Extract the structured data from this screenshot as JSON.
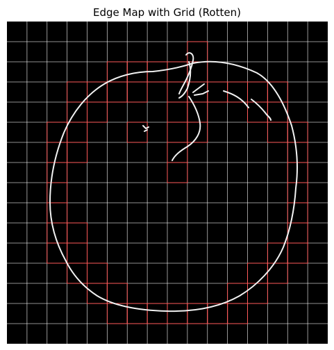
{
  "figure": {
    "title": "Edge Map with Grid (Rotten)"
  },
  "image": {
    "description_colors": {
      "background": "#000000",
      "edges": "#ffffff",
      "grid_lines": "#ffffff",
      "highlight_cells": "#ff5a5a"
    },
    "grid": {
      "columns": 16,
      "rows": 16,
      "highlighted_cells": [
        [
          1,
          9
        ],
        [
          2,
          5
        ],
        [
          2,
          6
        ],
        [
          2,
          7
        ],
        [
          2,
          8
        ],
        [
          2,
          9
        ],
        [
          3,
          3
        ],
        [
          3,
          4
        ],
        [
          3,
          5
        ],
        [
          3,
          6
        ],
        [
          3,
          8
        ],
        [
          3,
          9
        ],
        [
          3,
          10
        ],
        [
          3,
          11
        ],
        [
          3,
          12
        ],
        [
          3,
          13
        ],
        [
          4,
          3
        ],
        [
          4,
          4
        ],
        [
          4,
          8
        ],
        [
          4,
          9
        ],
        [
          4,
          12
        ],
        [
          4,
          13
        ],
        [
          5,
          2
        ],
        [
          5,
          3
        ],
        [
          5,
          6
        ],
        [
          5,
          8
        ],
        [
          5,
          9
        ],
        [
          5,
          13
        ],
        [
          5,
          14
        ],
        [
          6,
          2
        ],
        [
          6,
          3
        ],
        [
          6,
          8
        ],
        [
          6,
          14
        ],
        [
          7,
          2
        ],
        [
          7,
          8
        ],
        [
          7,
          14
        ],
        [
          8,
          2
        ],
        [
          8,
          14
        ],
        [
          9,
          2
        ],
        [
          9,
          14
        ],
        [
          10,
          2
        ],
        [
          10,
          3
        ],
        [
          10,
          14
        ],
        [
          11,
          2
        ],
        [
          11,
          3
        ],
        [
          11,
          13
        ],
        [
          11,
          14
        ],
        [
          12,
          3
        ],
        [
          12,
          4
        ],
        [
          12,
          12
        ],
        [
          12,
          13
        ],
        [
          13,
          4
        ],
        [
          13,
          5
        ],
        [
          13,
          11
        ],
        [
          13,
          12
        ],
        [
          14,
          5
        ],
        [
          14,
          6
        ],
        [
          14,
          7
        ],
        [
          14,
          8
        ],
        [
          14,
          9
        ],
        [
          14,
          10
        ],
        [
          14,
          11
        ]
      ]
    }
  }
}
